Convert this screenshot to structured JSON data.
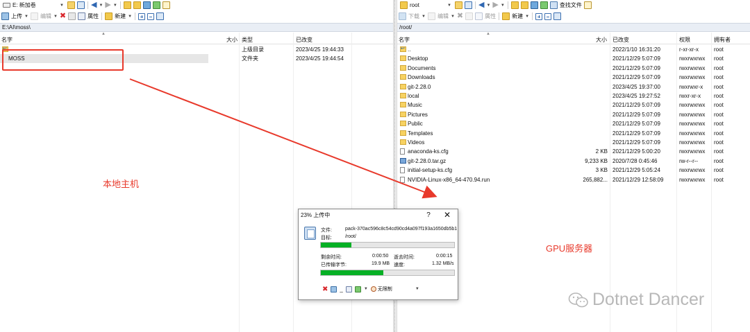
{
  "left_pane": {
    "toolbar1": {
      "drive_label": "E: 新加卷"
    },
    "toolbar2": {
      "upload": "上传",
      "edit": "编辑",
      "properties": "属性",
      "new": "新建"
    },
    "path": "E:\\AI\\moss\\",
    "columns": {
      "name": "名字",
      "size": "大小",
      "type": "类型",
      "modified": "已改变"
    },
    "rows": [
      {
        "name": "",
        "icon": "up-folder-icon",
        "type": "上级目录",
        "modified": "2023/4/25  19:44:33"
      },
      {
        "name": "MOSS",
        "icon": "folder-icon",
        "type": "文件夹",
        "modified": "2023/4/25  19:44:54",
        "selected": true
      }
    ]
  },
  "right_pane": {
    "toolbar1": {
      "dir_label": "root",
      "find_files": "查找文件"
    },
    "toolbar2": {
      "download": "下载",
      "edit": "编辑",
      "properties": "属性",
      "new": "新建"
    },
    "path": "/root/",
    "columns": {
      "name": "名字",
      "size": "大小",
      "modified": "已改变",
      "rights": "权限",
      "owner": "拥有者"
    },
    "rows": [
      {
        "name": "..",
        "icon": "up-folder-icon",
        "size": "",
        "modified": "2022/1/10 16:31:20",
        "rights": "r-xr-xr-x",
        "owner": "root"
      },
      {
        "name": "Desktop",
        "icon": "folder-icon",
        "size": "",
        "modified": "2021/12/29 5:07:09",
        "rights": "rwxrwxrwx",
        "owner": "root"
      },
      {
        "name": "Documents",
        "icon": "folder-icon",
        "size": "",
        "modified": "2021/12/29 5:07:09",
        "rights": "rwxrwxrwx",
        "owner": "root"
      },
      {
        "name": "Downloads",
        "icon": "folder-icon",
        "size": "",
        "modified": "2021/12/29 5:07:09",
        "rights": "rwxrwxrwx",
        "owner": "root"
      },
      {
        "name": "git-2.28.0",
        "icon": "folder-icon",
        "size": "",
        "modified": "2023/4/25 19:37:00",
        "rights": "rwxrwxr-x",
        "owner": "root"
      },
      {
        "name": "local",
        "icon": "folder-icon",
        "size": "",
        "modified": "2023/4/25 19:27:52",
        "rights": "rwxr-xr-x",
        "owner": "root"
      },
      {
        "name": "Music",
        "icon": "folder-icon",
        "size": "",
        "modified": "2021/12/29 5:07:09",
        "rights": "rwxrwxrwx",
        "owner": "root"
      },
      {
        "name": "Pictures",
        "icon": "folder-icon",
        "size": "",
        "modified": "2021/12/29 5:07:09",
        "rights": "rwxrwxrwx",
        "owner": "root"
      },
      {
        "name": "Public",
        "icon": "folder-icon",
        "size": "",
        "modified": "2021/12/29 5:07:09",
        "rights": "rwxrwxrwx",
        "owner": "root"
      },
      {
        "name": "Templates",
        "icon": "folder-icon",
        "size": "",
        "modified": "2021/12/29 5:07:09",
        "rights": "rwxrwxrwx",
        "owner": "root"
      },
      {
        "name": "Videos",
        "icon": "folder-icon",
        "size": "",
        "modified": "2021/12/29 5:07:09",
        "rights": "rwxrwxrwx",
        "owner": "root"
      },
      {
        "name": "anaconda-ks.cfg",
        "icon": "file-icon",
        "size": "2 KB",
        "modified": "2021/12/29 5:00:20",
        "rights": "rwxrwxrwx",
        "owner": "root"
      },
      {
        "name": "git-2.28.0.tar.gz",
        "icon": "archive-icon",
        "size": "9,233 KB",
        "modified": "2020/7/28 0:45:46",
        "rights": "rw-r--r--",
        "owner": "root"
      },
      {
        "name": "initial-setup-ks.cfg",
        "icon": "file-icon",
        "size": "3 KB",
        "modified": "2021/12/29 5:05:24",
        "rights": "rwxrwxrwx",
        "owner": "root"
      },
      {
        "name": "NVIDIA-Linux-x86_64-470.94.run",
        "icon": "file-icon",
        "size": "265,882...",
        "modified": "2021/12/29 12:58:09",
        "rights": "rwxrwxrwx",
        "owner": "root"
      }
    ]
  },
  "annotations": {
    "local_host": "本地主机",
    "gpu_server": "GPU服务器",
    "arrow_color": "#e8392b"
  },
  "dialog": {
    "title": "23% 上传中",
    "help": "?",
    "close": "✕",
    "file_label": "文件:",
    "file_value": "pack-370ac596c8c54cd90cd4a097f193a1650db5b1",
    "target_label": "目标:",
    "target_value": "/root/",
    "file_progress": 0.23,
    "remaining_label": "剩余时间:",
    "remaining_value": "0:00:50",
    "elapsed_label": "逝去时间:",
    "elapsed_value": "0:00:15",
    "transferred_label": "已传输字节:",
    "transferred_value": "19.9 MB",
    "speed_label": "速度:",
    "speed_value": "1.32 MB/s",
    "total_progress": 0.47,
    "speed_limit": "无限制"
  },
  "watermark": "Dotnet Dancer"
}
